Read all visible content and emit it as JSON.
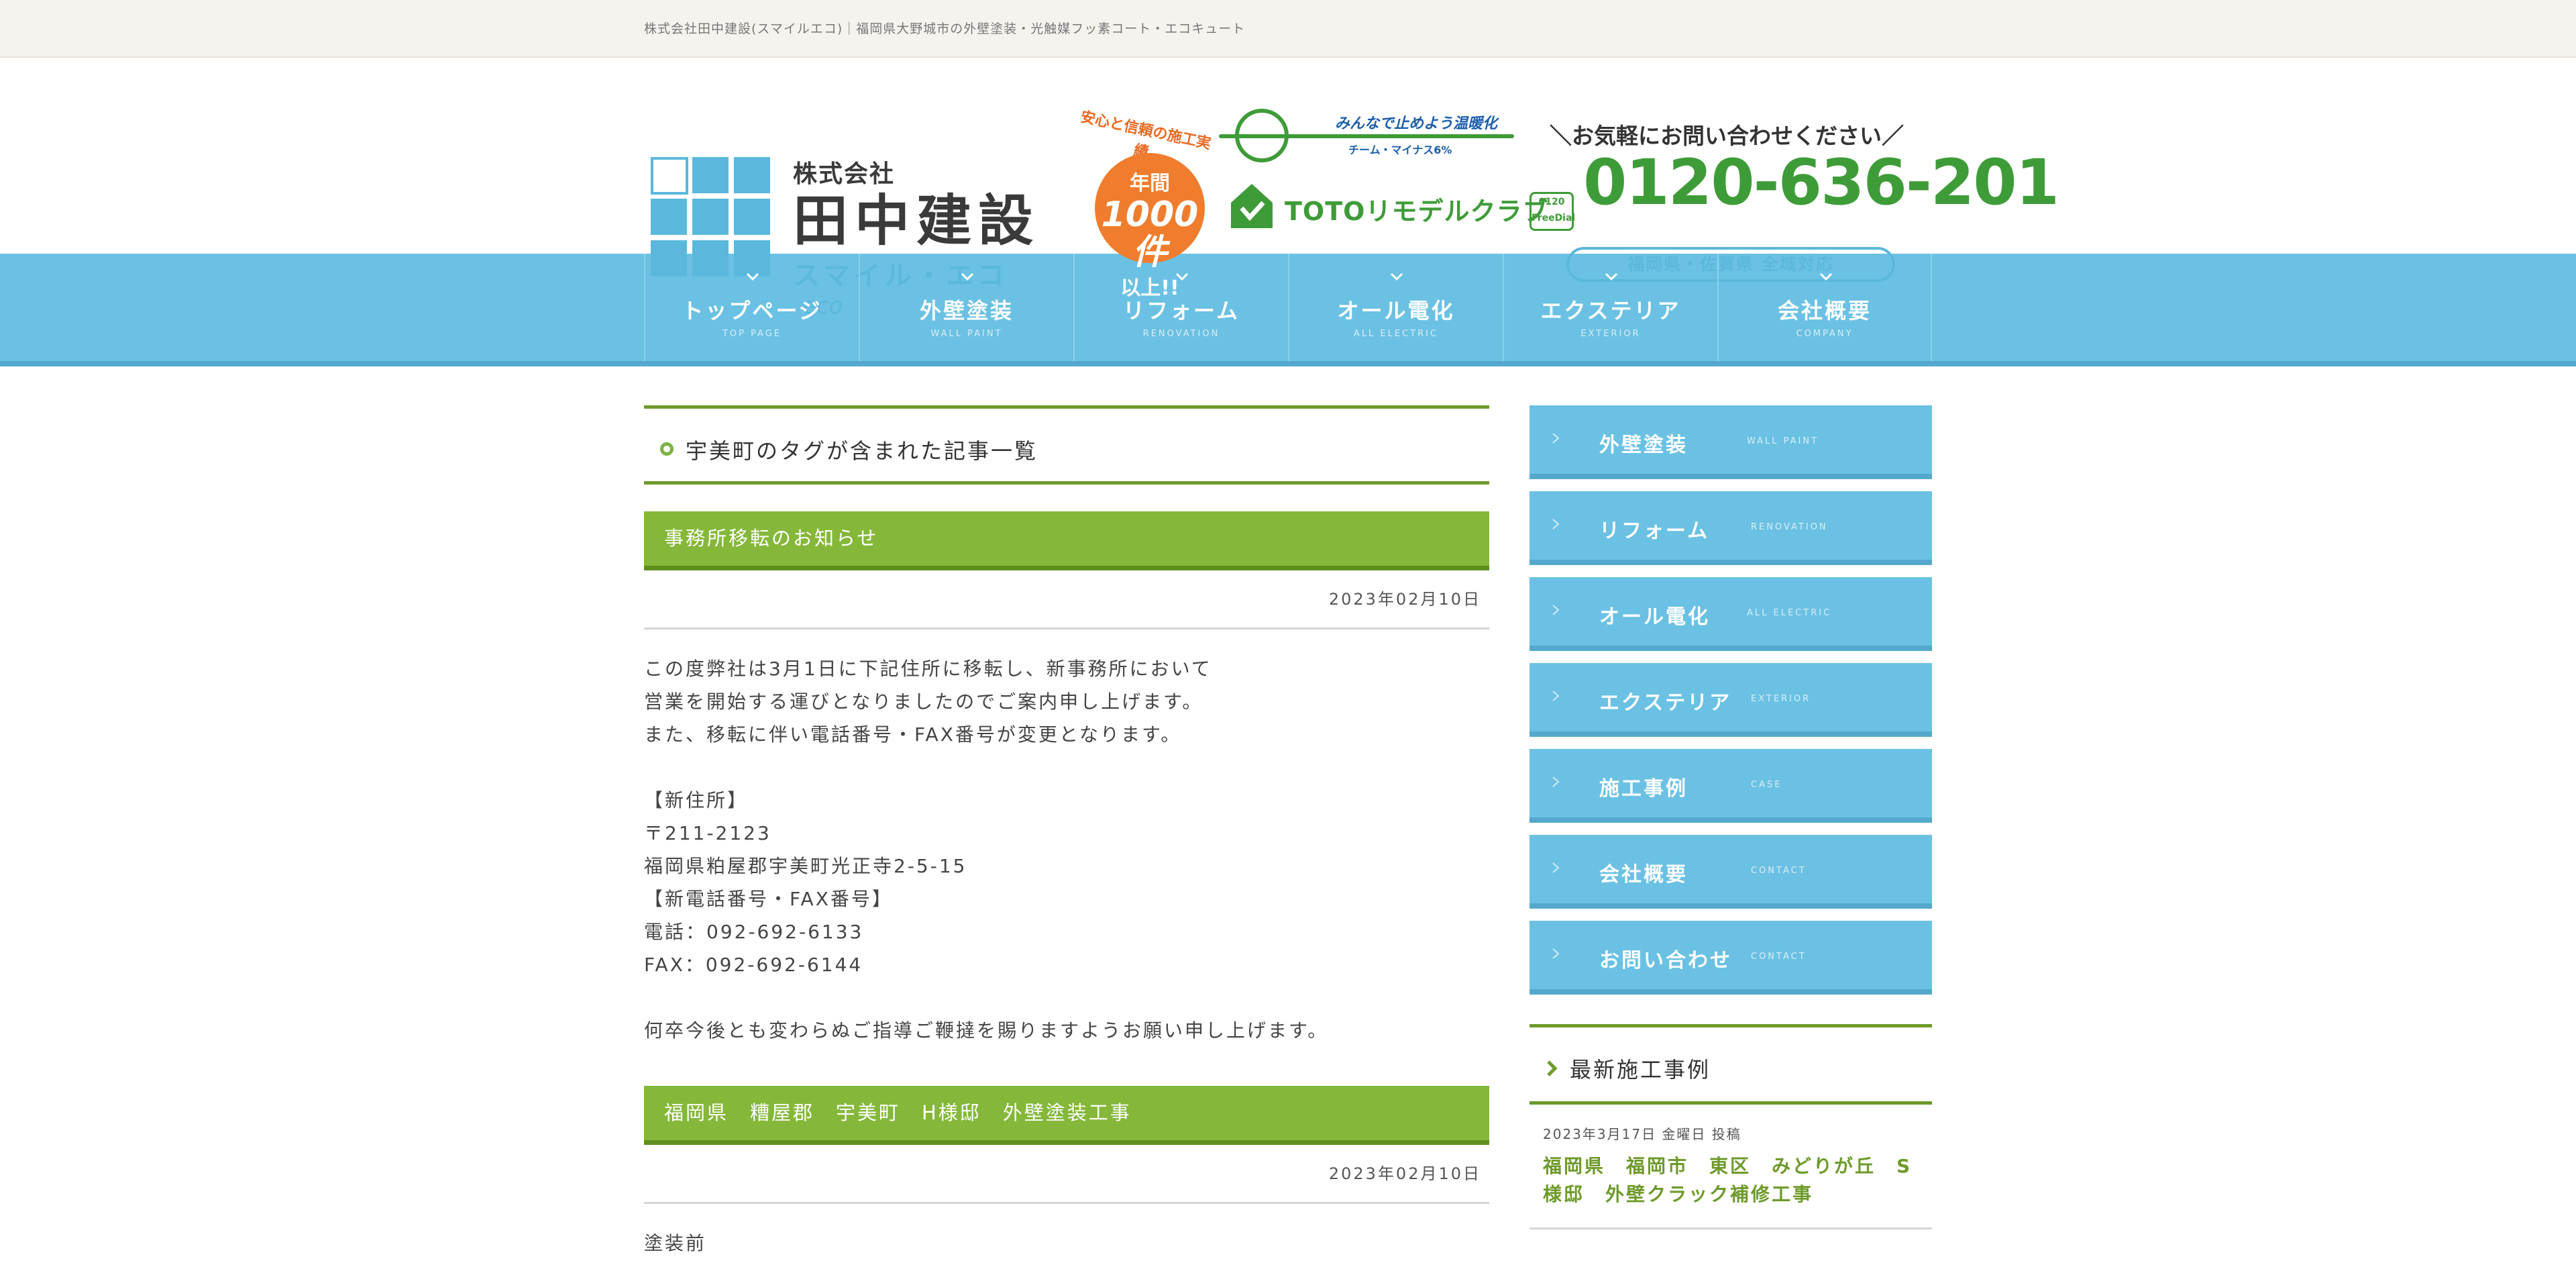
{
  "topbar": {
    "tagline": "株式会社田中建設(スマイルエコ)｜福岡県大野城市の外壁塗装・光触媒フッ素コート・エコキュート"
  },
  "header": {
    "logo": {
      "kabushiki": "株式会社",
      "name": "田中建設",
      "sub": "スマイル・エコ",
      "eco": "eco"
    },
    "badge": {
      "arc": "安心と信頼の施工実績",
      "line1": "年間",
      "line2": "1000件",
      "line3": "以上!!"
    },
    "warm": {
      "line1": "みんなで止めよう温暖化",
      "line2": "チーム・マイナス6%"
    },
    "toto": {
      "text": "TOTOリモデルクラブ"
    },
    "contact": {
      "ask": "＼お気軽にお問い合わせください／",
      "freedial_top": "0120",
      "freedial_bottom": "FreeDial",
      "tel": "0120-636-201",
      "area": "福岡県・佐賀県 全域対応"
    }
  },
  "nav": {
    "items": [
      {
        "jp": "トップページ",
        "en": "TOP PAGE"
      },
      {
        "jp": "外壁塗装",
        "en": "WALL PAINT"
      },
      {
        "jp": "リフォーム",
        "en": "RENOVATION"
      },
      {
        "jp": "オール電化",
        "en": "ALL ELECTRIC"
      },
      {
        "jp": "エクステリア",
        "en": "EXTERIOR"
      },
      {
        "jp": "会社概要",
        "en": "COMPANY"
      }
    ]
  },
  "archive": {
    "title": "宇美町のタグが含まれた記事一覧"
  },
  "posts": [
    {
      "title": "事務所移転のお知らせ",
      "date": "2023年02月10日",
      "lines": [
        "この度弊社は3月1日に下記住所に移転し、新事務所において",
        "営業を開始する運びとなりましたのでご案内申し上げます。",
        "また、移転に伴い電話番号・FAX番号が変更となります。",
        "【新住所】",
        "〒211-2123",
        "福岡県粕屋郡宇美町光正寺2-5-15",
        "【新電話番号・FAX番号】",
        "電話：092-692-6133",
        "FAX：092-692-6144",
        "何卒今後とも変わらぬご指導ご鞭撻を賜りますようお願い申し上げます。"
      ]
    },
    {
      "title": "福岡県　糟屋郡　宇美町　H様邸　外壁塗装工事",
      "date": "2023年02月10日",
      "first_line": "塗装前"
    }
  ],
  "sidebar": {
    "buttons": [
      {
        "jp": "外壁塗装",
        "en": "WALL PAINT"
      },
      {
        "jp": "リフォーム",
        "en": "RENOVATION"
      },
      {
        "jp": "オール電化",
        "en": "ALL ELECTRIC"
      },
      {
        "jp": "エクステリア",
        "en": "EXTERIOR"
      },
      {
        "jp": "施工事例",
        "en": "CASE"
      },
      {
        "jp": "会社概要",
        "en": "CONTACT"
      },
      {
        "jp": "お問い合わせ",
        "en": "CONTACT"
      }
    ],
    "recent": {
      "title": "最新施工事例",
      "item": {
        "meta": "2023年3月17日 金曜日 投稿",
        "title": "福岡県　福岡市　東区　みどりが丘　S様邸　外壁クラック補修工事"
      }
    }
  },
  "colors": {
    "nav_blue": "#6bc1e3",
    "green": "#85b83a",
    "green_dark": "#6e9a2a",
    "tel_green": "#3e9c38",
    "badge_orange": "#ef7d2d"
  }
}
